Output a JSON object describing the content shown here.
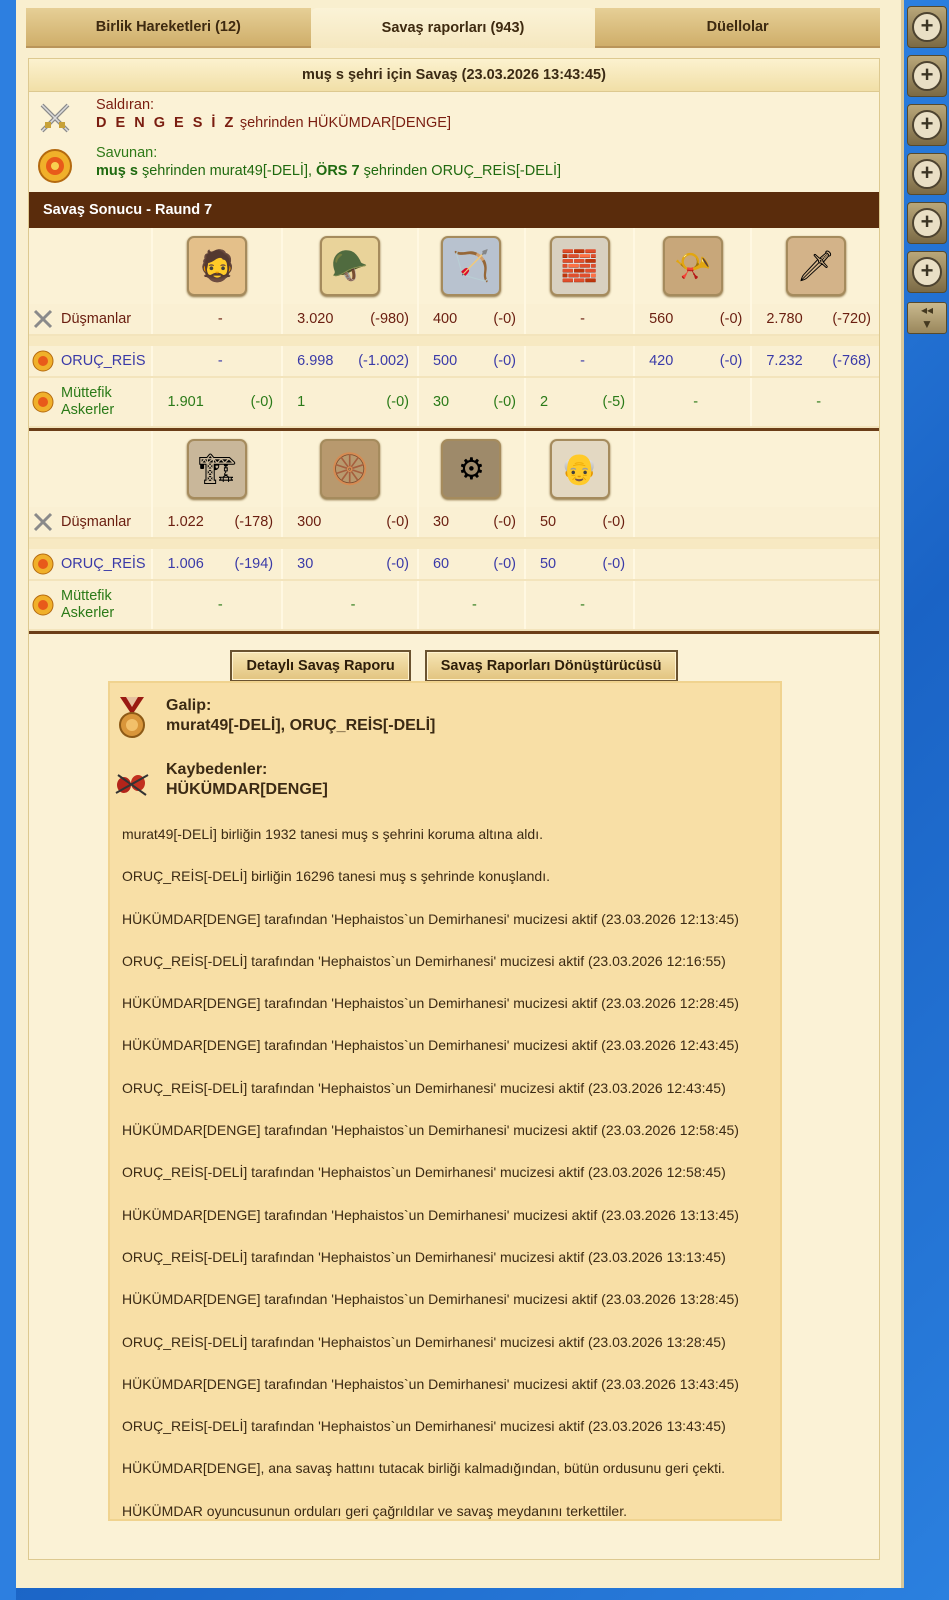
{
  "tabs": [
    "Birlik Hareketleri (12)",
    "Savaş raporları (943)",
    "Düellolar"
  ],
  "report": {
    "title": "muş s şehri için Savaş (23.03.2026 13:43:45)",
    "attacker_label": "Saldıran:",
    "attacker_city": "D E N G E S İ Z",
    "attacker_text": " şehrinden HÜKÜMDAR[DENGE]",
    "defender_label": "Savunan:",
    "defender_city1": "muş s",
    "defender_text1": " şehrinden murat49[-DELİ], ",
    "defender_city2": "ÖRS 7",
    "defender_text2": " şehrinden ORUÇ_REİS[-DELİ]",
    "round_title": "Savaş Sonucu - Raund 7"
  },
  "rows_labels": {
    "enemies": "Düşmanlar",
    "own": "ORUÇ_REİS",
    "ally1": "Müttefik",
    "ally2": "Askerler"
  },
  "block1": {
    "icons": [
      "hoplite-icon",
      "spartan-icon",
      "archer-icon",
      "wall-icon",
      "slinger-icon",
      "swordsman-icon"
    ],
    "enemies": [
      [
        "-",
        ""
      ],
      [
        "3.020",
        "(-980)"
      ],
      [
        "400",
        "(-0)"
      ],
      [
        "-",
        ""
      ],
      [
        "560",
        "(-0)"
      ],
      [
        "2.780",
        "(-720)"
      ]
    ],
    "own": [
      [
        "-",
        ""
      ],
      [
        "6.998",
        "(-1.002)"
      ],
      [
        "500",
        "(-0)"
      ],
      [
        "-",
        ""
      ],
      [
        "420",
        "(-0)"
      ],
      [
        "7.232",
        "(-768)"
      ]
    ],
    "ally": [
      [
        "1.901",
        "(-0)"
      ],
      [
        "1",
        "(-0)"
      ],
      [
        "30",
        "(-0)"
      ],
      [
        "2",
        "(-5)"
      ],
      [
        "-",
        ""
      ],
      [
        "-",
        ""
      ]
    ]
  },
  "block2": {
    "icons": [
      "ram-icon",
      "catapult-icon",
      "mortar-icon",
      "doctor-icon"
    ],
    "enemies": [
      [
        "1.022",
        "(-178)"
      ],
      [
        "300",
        "(-0)"
      ],
      [
        "30",
        "(-0)"
      ],
      [
        "50",
        "(-0)"
      ]
    ],
    "own": [
      [
        "1.006",
        "(-194)"
      ],
      [
        "30",
        "(-0)"
      ],
      [
        "60",
        "(-0)"
      ],
      [
        "50",
        "(-0)"
      ]
    ],
    "ally": [
      [
        "-",
        ""
      ],
      [
        "-",
        ""
      ],
      [
        "-",
        ""
      ],
      [
        "-",
        ""
      ]
    ]
  },
  "buttons": {
    "detail": "Detaylı Savaş Raporu",
    "converter": "Savaş Raporları Dönüştürücüsü"
  },
  "result": {
    "winner_label": "Galip:",
    "winners": "murat49[-DELİ], ORUÇ_REİS[-DELİ]",
    "loser_label": "Kaybedenler:",
    "losers": "HÜKÜMDAR[DENGE]",
    "messages": [
      "murat49[-DELİ] birliğin 1932 tanesi muş s şehrini koruma altına aldı.",
      "ORUÇ_REİS[-DELİ] birliğin 16296 tanesi muş s şehrinde konuşlandı.",
      "HÜKÜMDAR[DENGE] tarafından 'Hephaistos`un Demirhanesi' mucizesi aktif (23.03.2026 12:13:45)",
      "ORUÇ_REİS[-DELİ] tarafından 'Hephaistos`un Demirhanesi' mucizesi aktif (23.03.2026 12:16:55)",
      "HÜKÜMDAR[DENGE] tarafından 'Hephaistos`un Demirhanesi' mucizesi aktif (23.03.2026 12:28:45)",
      "HÜKÜMDAR[DENGE] tarafından 'Hephaistos`un Demirhanesi' mucizesi aktif (23.03.2026 12:43:45)",
      "ORUÇ_REİS[-DELİ] tarafından 'Hephaistos`un Demirhanesi' mucizesi aktif (23.03.2026 12:43:45)",
      "HÜKÜMDAR[DENGE] tarafından 'Hephaistos`un Demirhanesi' mucizesi aktif (23.03.2026 12:58:45)",
      "ORUÇ_REİS[-DELİ] tarafından 'Hephaistos`un Demirhanesi' mucizesi aktif (23.03.2026 12:58:45)",
      "HÜKÜMDAR[DENGE] tarafından 'Hephaistos`un Demirhanesi' mucizesi aktif (23.03.2026 13:13:45)",
      "ORUÇ_REİS[-DELİ] tarafından 'Hephaistos`un Demirhanesi' mucizesi aktif (23.03.2026 13:13:45)",
      "HÜKÜMDAR[DENGE] tarafından 'Hephaistos`un Demirhanesi' mucizesi aktif (23.03.2026 13:28:45)",
      "ORUÇ_REİS[-DELİ] tarafından 'Hephaistos`un Demirhanesi' mucizesi aktif (23.03.2026 13:28:45)",
      "HÜKÜMDAR[DENGE] tarafından 'Hephaistos`un Demirhanesi' mucizesi aktif (23.03.2026 13:43:45)",
      "ORUÇ_REİS[-DELİ] tarafından 'Hephaistos`un Demirhanesi' mucizesi aktif (23.03.2026 13:43:45)",
      "HÜKÜMDAR[DENGE], ana savaş hattını tutacak birliği kalmadığından, bütün ordusunu geri çekti.",
      "HÜKÜMDAR oyuncusunun orduları geri çağrıldılar ve savaş meydanını terkettiler."
    ]
  },
  "sidebar": {
    "plus_buttons": [
      "+",
      "+",
      "+",
      "+",
      "+",
      "+"
    ],
    "scroll": "◂◂"
  },
  "colors": {
    "panel": "#f9efcf",
    "round_bar": "#5a2c0c",
    "enemy": "#6a1e10",
    "own": "#3a3aa8",
    "ally": "#2a7a18",
    "result_bg": "#f8dfa6"
  }
}
